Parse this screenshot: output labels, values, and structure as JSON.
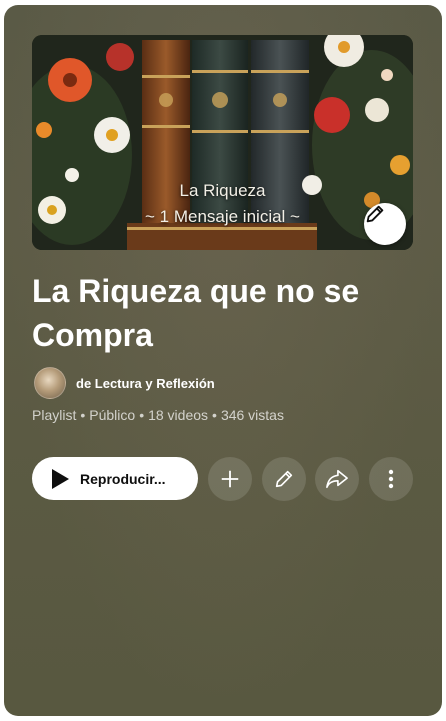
{
  "thumbnail": {
    "title_line1": "La Riqueza",
    "title_line2": "~ 1 Mensaje inicial ~",
    "edit_icon": "pencil-icon"
  },
  "playlist": {
    "title": "La Riqueza que no se Compra",
    "owner": "de Lectura y Reflexión",
    "type": "Playlist",
    "visibility": "Público",
    "videos": "18 videos",
    "views": "346 vistas"
  },
  "actions": {
    "play_label": "Reproducir...",
    "play_icon": "play-icon",
    "add_icon": "plus-icon",
    "edit_icon": "pencil-icon",
    "share_icon": "share-icon",
    "more_icon": "more-vertical-icon"
  },
  "colors": {
    "panel_bg": "#5c5b45",
    "button_bg": "#ffffff",
    "text": "#ffffff"
  }
}
